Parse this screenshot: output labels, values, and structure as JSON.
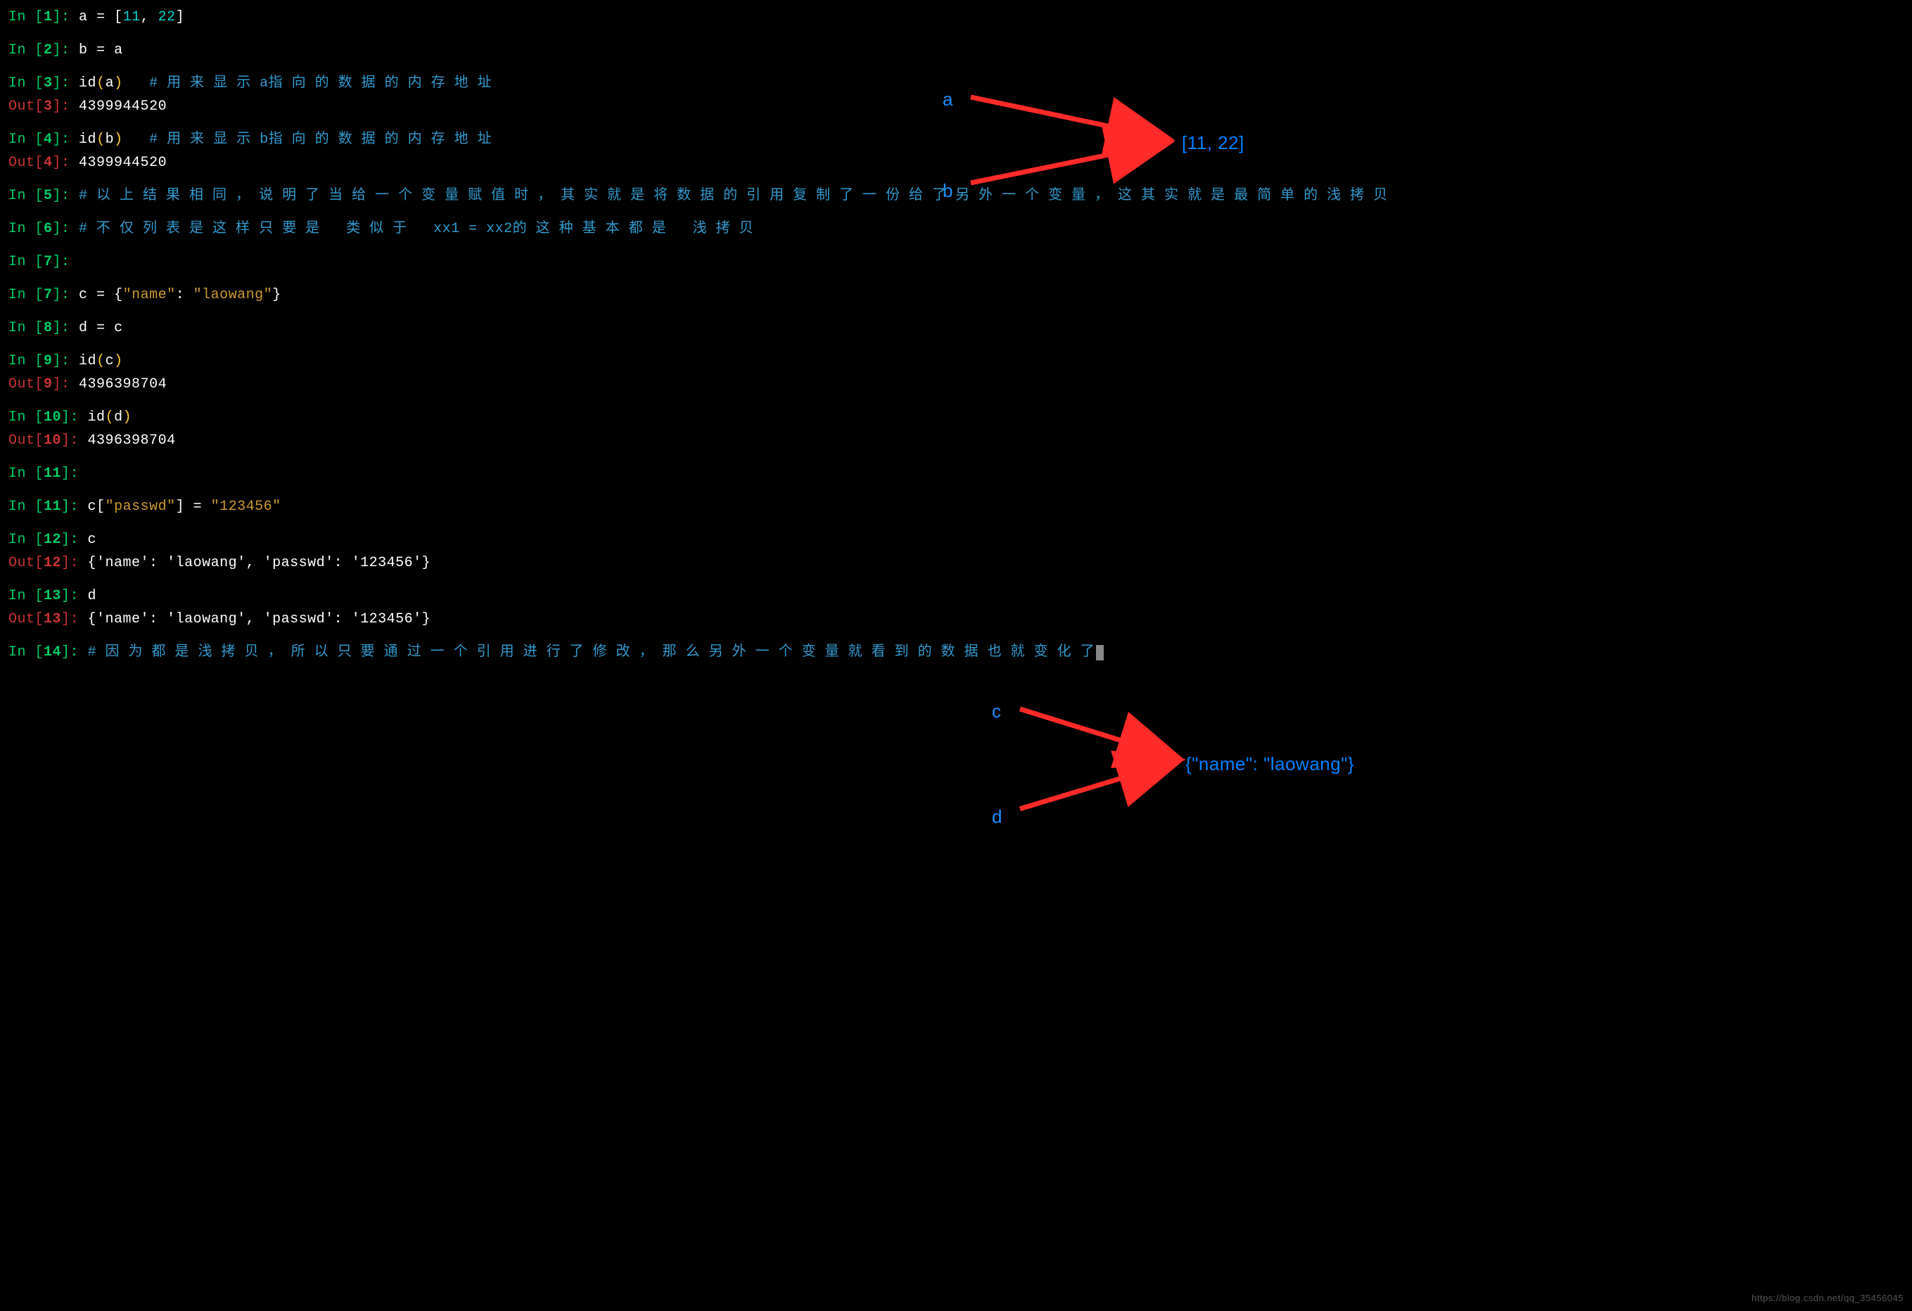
{
  "lines": [
    {
      "type": "in",
      "n": "1",
      "tokens": [
        {
          "t": "code",
          "v": "a "
        },
        {
          "t": "code",
          "v": "= "
        },
        {
          "t": "code",
          "v": "["
        },
        {
          "t": "number",
          "v": "11"
        },
        {
          "t": "code",
          "v": ", "
        },
        {
          "t": "number",
          "v": "22"
        },
        {
          "t": "code",
          "v": "]"
        }
      ]
    },
    {
      "type": "blank"
    },
    {
      "type": "in",
      "n": "2",
      "tokens": [
        {
          "t": "code",
          "v": "b "
        },
        {
          "t": "code",
          "v": "= "
        },
        {
          "t": "code",
          "v": "a"
        }
      ]
    },
    {
      "type": "blank"
    },
    {
      "type": "in",
      "n": "3",
      "tokens": [
        {
          "t": "code",
          "v": "id"
        },
        {
          "t": "paren",
          "v": "("
        },
        {
          "t": "code",
          "v": "a"
        },
        {
          "t": "paren",
          "v": ")"
        },
        {
          "t": "code",
          "v": "   "
        },
        {
          "t": "comment",
          "v": "# 用 来 显 示 a指 向 的 数 据 的 内 存 地 址"
        }
      ]
    },
    {
      "type": "out",
      "n": "3",
      "tokens": [
        {
          "t": "output",
          "v": "4399944520"
        }
      ]
    },
    {
      "type": "blank"
    },
    {
      "type": "in",
      "n": "4",
      "tokens": [
        {
          "t": "code",
          "v": "id"
        },
        {
          "t": "paren",
          "v": "("
        },
        {
          "t": "code",
          "v": "b"
        },
        {
          "t": "paren",
          "v": ")"
        },
        {
          "t": "code",
          "v": "   "
        },
        {
          "t": "comment",
          "v": "# 用 来 显 示 b指 向 的 数 据 的 内 存 地 址"
        }
      ]
    },
    {
      "type": "out",
      "n": "4",
      "tokens": [
        {
          "t": "output",
          "v": "4399944520"
        }
      ]
    },
    {
      "type": "blank"
    },
    {
      "type": "in",
      "n": "5",
      "tokens": [
        {
          "t": "comment",
          "v": "# 以 上 结 果 相 同 ， 说 明 了 当 给 一 个 变 量 赋 值 时 ， 其 实 就 是 将 数 据 的 引 用 复 制 了 一 份 给 了 另 外 一 个 变 量 ， 这 其 实 就 是 最 简 单 的 浅 拷 贝"
        }
      ]
    },
    {
      "type": "blank"
    },
    {
      "type": "in",
      "n": "6",
      "tokens": [
        {
          "t": "comment",
          "v": "# 不 仅 列 表 是 这 样 只 要 是   类 似 于   xx1 = xx2的 这 种 基 本 都 是   浅 拷 贝"
        }
      ]
    },
    {
      "type": "blank"
    },
    {
      "type": "in",
      "n": "7",
      "tokens": []
    },
    {
      "type": "blank"
    },
    {
      "type": "in",
      "n": "7",
      "tokens": [
        {
          "t": "code",
          "v": "c "
        },
        {
          "t": "code",
          "v": "= "
        },
        {
          "t": "code",
          "v": "{"
        },
        {
          "t": "string",
          "v": "\"name\""
        },
        {
          "t": "code",
          "v": ": "
        },
        {
          "t": "string",
          "v": "\"laowang\""
        },
        {
          "t": "code",
          "v": "}"
        }
      ]
    },
    {
      "type": "blank"
    },
    {
      "type": "in",
      "n": "8",
      "tokens": [
        {
          "t": "code",
          "v": "d "
        },
        {
          "t": "code",
          "v": "= "
        },
        {
          "t": "code",
          "v": "c"
        }
      ]
    },
    {
      "type": "blank"
    },
    {
      "type": "in",
      "n": "9",
      "tokens": [
        {
          "t": "code",
          "v": "id"
        },
        {
          "t": "paren",
          "v": "("
        },
        {
          "t": "code",
          "v": "c"
        },
        {
          "t": "paren",
          "v": ")"
        }
      ]
    },
    {
      "type": "out",
      "n": "9",
      "tokens": [
        {
          "t": "output",
          "v": "4396398704"
        }
      ]
    },
    {
      "type": "blank"
    },
    {
      "type": "in",
      "n": "10",
      "tokens": [
        {
          "t": "code",
          "v": "id"
        },
        {
          "t": "paren",
          "v": "("
        },
        {
          "t": "code",
          "v": "d"
        },
        {
          "t": "paren",
          "v": ")"
        }
      ]
    },
    {
      "type": "out",
      "n": "10",
      "tokens": [
        {
          "t": "output",
          "v": "4396398704"
        }
      ]
    },
    {
      "type": "blank"
    },
    {
      "type": "in",
      "n": "11",
      "tokens": []
    },
    {
      "type": "blank"
    },
    {
      "type": "in",
      "n": "11",
      "tokens": [
        {
          "t": "code",
          "v": "c["
        },
        {
          "t": "string",
          "v": "\"passwd\""
        },
        {
          "t": "code",
          "v": "] "
        },
        {
          "t": "code",
          "v": "= "
        },
        {
          "t": "string",
          "v": "\"123456\""
        }
      ]
    },
    {
      "type": "blank"
    },
    {
      "type": "in",
      "n": "12",
      "tokens": [
        {
          "t": "code",
          "v": "c"
        }
      ]
    },
    {
      "type": "out",
      "n": "12",
      "tokens": [
        {
          "t": "output",
          "v": "{'name': 'laowang', 'passwd': '123456'}"
        }
      ]
    },
    {
      "type": "blank"
    },
    {
      "type": "in",
      "n": "13",
      "tokens": [
        {
          "t": "code",
          "v": "d"
        }
      ]
    },
    {
      "type": "out",
      "n": "13",
      "tokens": [
        {
          "t": "output",
          "v": "{'name': 'laowang', 'passwd': '123456'}"
        }
      ]
    },
    {
      "type": "blank"
    },
    {
      "type": "in",
      "n": "14",
      "tokens": [
        {
          "t": "comment",
          "v": "# 因 为 都 是 浅 拷 贝 ， 所 以 只 要 通 过 一 个 引 用 进 行 了 修 改 ， 那 么 另 外 一 个 变 量 就 看 到 的 数 据 也 就 变 化 了"
        }
      ],
      "cursor": true
    }
  ],
  "diagram1": {
    "label_a": "a",
    "label_b": "b",
    "target": "[11, 22]"
  },
  "diagram2": {
    "label_c": "c",
    "label_d": "d",
    "target": "{\"name\": \"laowang\"}"
  },
  "watermark": "https://blog.csdn.net/qq_35456045"
}
